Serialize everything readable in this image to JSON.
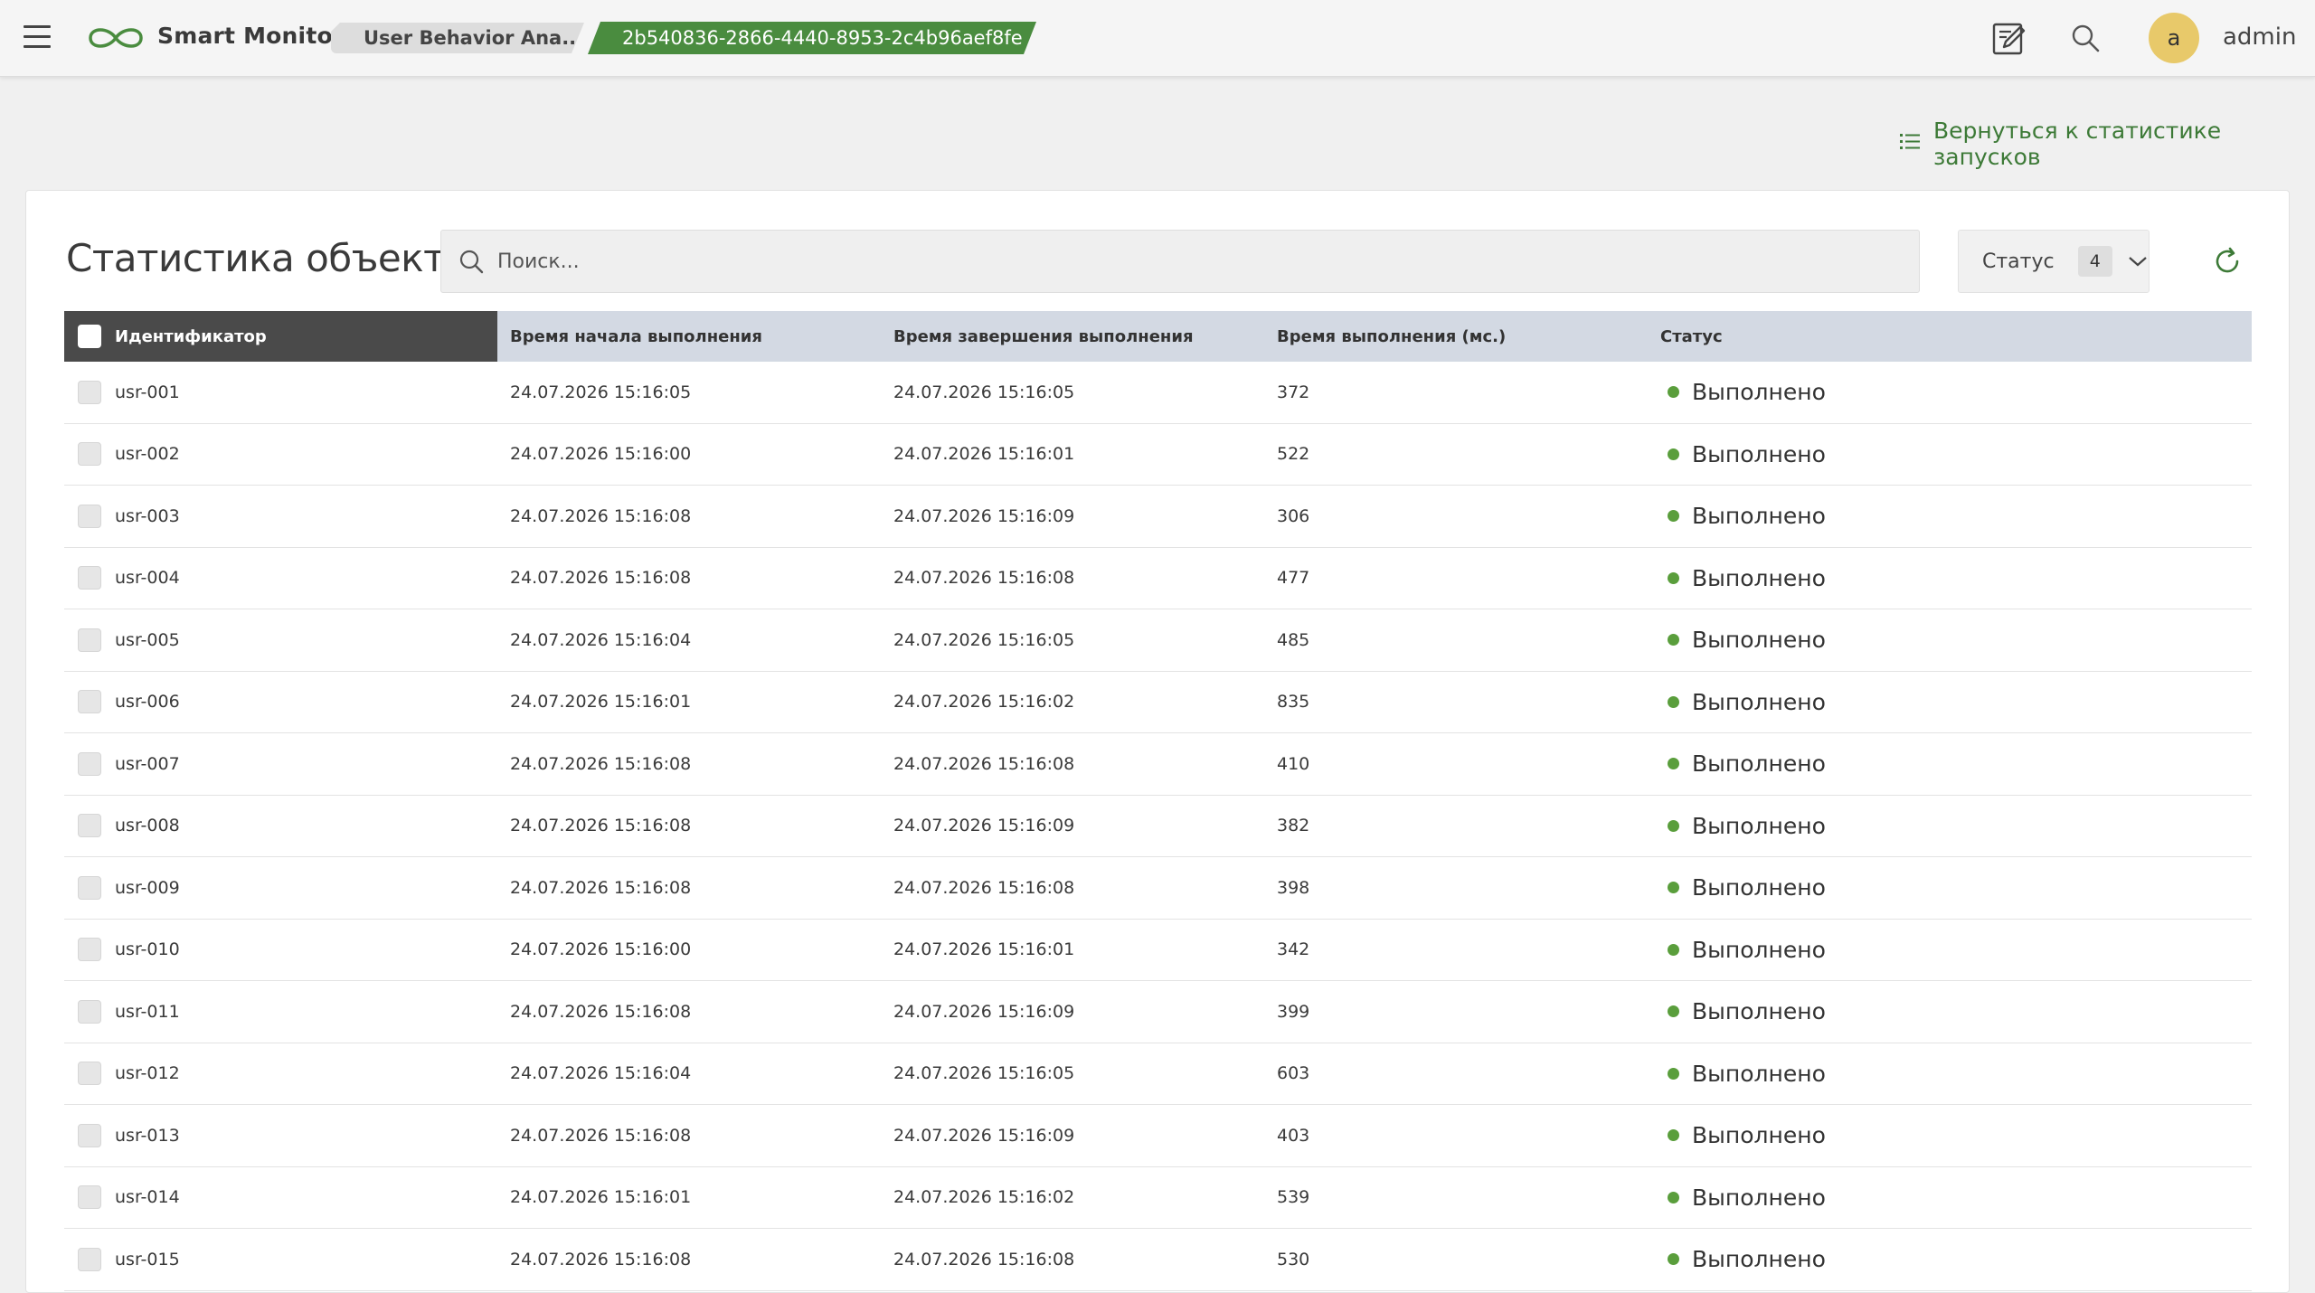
{
  "header": {
    "app_name": "Smart Monitor",
    "breadcrumb_project": "User Behavior Ana...",
    "breadcrumb_run_id": "2b540836-2866-4440-8953-2c4b96aef8fe",
    "user_initial": "a",
    "username": "admin",
    "icons": {
      "menu": "hamburger-icon",
      "logo": "infinity-logo-icon",
      "edit": "edit-note-icon",
      "search": "search-icon"
    }
  },
  "back_link": {
    "label": "Вернуться к статистике запусков",
    "icon": "list-icon"
  },
  "card": {
    "title": "Статистика объектов",
    "search": {
      "placeholder": "Поиск...",
      "value": ""
    },
    "status_filter": {
      "label": "Статус",
      "count": "4"
    }
  },
  "table": {
    "columns": {
      "id": "Идентификатор",
      "start": "Время начала выполнения",
      "end": "Время завершения выполнения",
      "duration": "Время выполнения (мс.)",
      "status": "Статус"
    },
    "rows": [
      {
        "id": "usr-001",
        "start": "24.07.2026 15:16:05",
        "end": "24.07.2026 15:16:05",
        "duration": "372",
        "status": "Выполнено"
      },
      {
        "id": "usr-002",
        "start": "24.07.2026 15:16:00",
        "end": "24.07.2026 15:16:01",
        "duration": "522",
        "status": "Выполнено"
      },
      {
        "id": "usr-003",
        "start": "24.07.2026 15:16:08",
        "end": "24.07.2026 15:16:09",
        "duration": "306",
        "status": "Выполнено"
      },
      {
        "id": "usr-004",
        "start": "24.07.2026 15:16:08",
        "end": "24.07.2026 15:16:08",
        "duration": "477",
        "status": "Выполнено"
      },
      {
        "id": "usr-005",
        "start": "24.07.2026 15:16:04",
        "end": "24.07.2026 15:16:05",
        "duration": "485",
        "status": "Выполнено"
      },
      {
        "id": "usr-006",
        "start": "24.07.2026 15:16:01",
        "end": "24.07.2026 15:16:02",
        "duration": "835",
        "status": "Выполнено"
      },
      {
        "id": "usr-007",
        "start": "24.07.2026 15:16:08",
        "end": "24.07.2026 15:16:08",
        "duration": "410",
        "status": "Выполнено"
      },
      {
        "id": "usr-008",
        "start": "24.07.2026 15:16:08",
        "end": "24.07.2026 15:16:09",
        "duration": "382",
        "status": "Выполнено"
      },
      {
        "id": "usr-009",
        "start": "24.07.2026 15:16:08",
        "end": "24.07.2026 15:16:08",
        "duration": "398",
        "status": "Выполнено"
      },
      {
        "id": "usr-010",
        "start": "24.07.2026 15:16:00",
        "end": "24.07.2026 15:16:01",
        "duration": "342",
        "status": "Выполнено"
      },
      {
        "id": "usr-011",
        "start": "24.07.2026 15:16:08",
        "end": "24.07.2026 15:16:09",
        "duration": "399",
        "status": "Выполнено"
      },
      {
        "id": "usr-012",
        "start": "24.07.2026 15:16:04",
        "end": "24.07.2026 15:16:05",
        "duration": "603",
        "status": "Выполнено"
      },
      {
        "id": "usr-013",
        "start": "24.07.2026 15:16:08",
        "end": "24.07.2026 15:16:09",
        "duration": "403",
        "status": "Выполнено"
      },
      {
        "id": "usr-014",
        "start": "24.07.2026 15:16:01",
        "end": "24.07.2026 15:16:02",
        "duration": "539",
        "status": "Выполнено"
      },
      {
        "id": "usr-015",
        "start": "24.07.2026 15:16:08",
        "end": "24.07.2026 15:16:08",
        "duration": "530",
        "status": "Выполнено"
      }
    ]
  },
  "colors": {
    "accent_green": "#4a8c3f",
    "status_success": "#5a9e3c",
    "header_dark": "#4a4a4a",
    "table_header": "#d3d9e3",
    "avatar": "#e8c96a"
  }
}
